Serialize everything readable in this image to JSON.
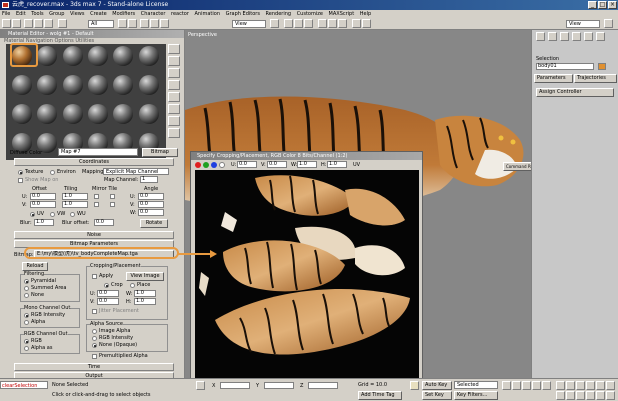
{
  "app": {
    "title": "云虎_recover.max - 3ds max 7 - Stand-alone License",
    "min_label": "_",
    "max_label": "□",
    "close_label": "×"
  },
  "menu": [
    "File",
    "Edit",
    "Tools",
    "Group",
    "Views",
    "Create",
    "Modifiers",
    "Character",
    "reactor",
    "Animation",
    "Graph Editors",
    "Rendering",
    "Customize",
    "MAXScript",
    "Help"
  ],
  "toolbar": {
    "filter_value": "All",
    "view1_value": "View",
    "view2_value": "View"
  },
  "material_editor": {
    "title": "Material Editor - wolg #1 - Default",
    "menu": "Material  Navigation  Options  Utilities",
    "diffuse_label": "Diffuse Color",
    "map_name": "Map #7",
    "map_type": "Bitmap",
    "coordinates": {
      "header": "Coordinates",
      "texture_label": "Texture",
      "environ_label": "Environ",
      "mapping_label": "Mapping:",
      "mapping_value": "Explicit Map Channel",
      "show_map_label": "Show Map on",
      "map_channel_label": "Map Channel:",
      "map_channel_value": "1",
      "offset_label": "Offset",
      "tiling_label": "Tiling",
      "mirror_tile_label": "Mirror Tile",
      "angle_label": "Angle",
      "u_label": "U:",
      "v_label": "V:",
      "w_label": "W:",
      "u_offset": "0.0",
      "v_offset": "0.0",
      "u_tiling": "1.0",
      "v_tiling": "1.0",
      "u_angle": "0.0",
      "v_angle": "0.0",
      "w_angle": "0.0",
      "uv_label": "UV",
      "vw_label": "VW",
      "wu_label": "WU",
      "blur_label": "Blur:",
      "blur_value": "1.0",
      "blur_offset_label": "Blur offset:",
      "blur_offset_value": "0.0",
      "rotate_label": "Rotate"
    },
    "noise_header": "Noise",
    "bitmap_params": {
      "header": "Bitmap Parameters",
      "bitmap_label": "Bitmap:",
      "bitmap_path": "E:\\my\\模型(虎)\\tv_bodyCompleteMap.tga",
      "reload_label": "Reload",
      "filtering_label": "Filtering",
      "pyramidal_label": "Pyramidal",
      "summed_area_label": "Summed Area",
      "none_label": "None",
      "mono_label": "Mono Channel Out",
      "rgb_int_label": "RGB Intensity",
      "alpha_label": "Alpha",
      "rgb_out_label": "RGB Channel Out",
      "rgb_label": "RGB",
      "alpha_as_label": "Alpha as",
      "cropping_label": "Cropping/Placement",
      "apply_label": "Apply",
      "view_image_label": "View Image",
      "crop_label": "Crop",
      "place_label": "Place",
      "u_value": "0.0",
      "v_value": "0.0",
      "w_value": "1.0",
      "h_value": "1.0",
      "jitter_label": "Jitter Placement",
      "alpha_source_label": "Alpha Source",
      "image_alpha_label": "Image Alpha",
      "rgb_intensity_label": "RGB Intensity",
      "none2_label": "None (Opaque)",
      "premultiplied_label": "Premultiplied Alpha"
    },
    "time_header": "Time",
    "output_header": "Output"
  },
  "crop_window": {
    "title": "Specify Cropping/Placement, RGB Color 8 Bits/Channel (1:2)",
    "u_label": "U:",
    "u_value": "0.0",
    "v_label": "V:",
    "v_value": "0.0",
    "w_label": "W:",
    "w_value": "1.0",
    "h_label": "H:",
    "h_value": "1.0",
    "uv_label": "UV"
  },
  "viewport": {
    "label": "Perspective",
    "tooltip": "Command Panel"
  },
  "right_panel": {
    "selection_label": "Selection",
    "object_name": "body01",
    "tab_params": "Parameters",
    "tab_traj": "Trajectories",
    "assign_label": "Assign Controller"
  },
  "status": {
    "listener": "clearSelection",
    "none_selected": "None Selected",
    "prompt": "Click or click-and-drag to select objects",
    "x_label": "X",
    "y_label": "Y",
    "z_label": "Z",
    "grid_label": "Grid = 10.0",
    "add_time_tag": "Add Time Tag",
    "auto_key": "Auto Key",
    "set_key": "Set Key",
    "selected": "Selected",
    "key_filters": "Key Filters..."
  },
  "colors": {
    "callout": "#e89a40",
    "title_bar": "#0a246a",
    "viewport_bg": "#878787"
  }
}
